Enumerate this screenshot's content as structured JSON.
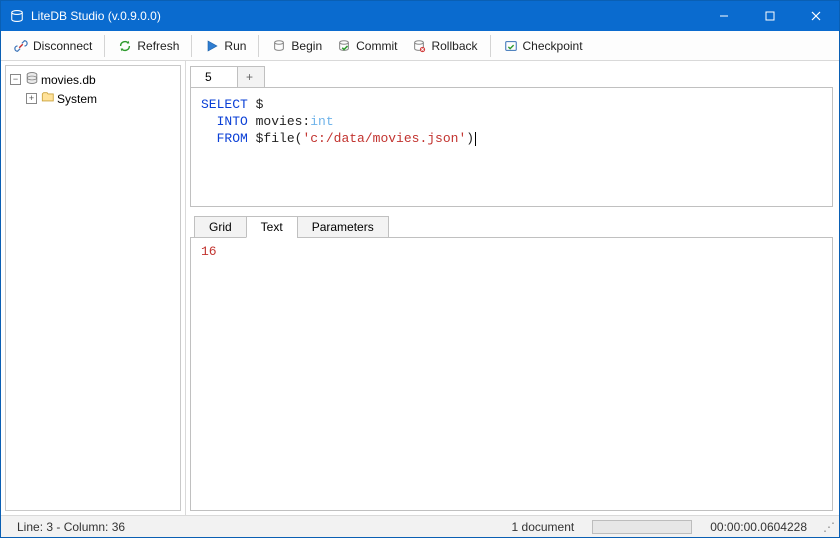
{
  "window": {
    "title": "LiteDB Studio (v.0.9.0.0)"
  },
  "toolbar": {
    "disconnect": "Disconnect",
    "refresh": "Refresh",
    "run": "Run",
    "begin": "Begin",
    "commit": "Commit",
    "rollback": "Rollback",
    "checkpoint": "Checkpoint"
  },
  "tree": {
    "root": "movies.db",
    "child1": "System"
  },
  "queryTabs": {
    "active": "5",
    "add": "+"
  },
  "editor": {
    "tokens": {
      "select": "SELECT",
      "dollar": " $",
      "into": "INTO",
      "target": " movies:",
      "type": "int",
      "from": "FROM",
      "filefn": " $file(",
      "path": "'c:/data/movies.json'",
      "close": ")"
    }
  },
  "resultTabs": {
    "grid": "Grid",
    "text": "Text",
    "parameters": "Parameters"
  },
  "results": {
    "value": "16"
  },
  "status": {
    "cursor": "Line: 3 - Column: 36",
    "docs": "1 document",
    "elapsed": "00:00:00.0604228"
  }
}
